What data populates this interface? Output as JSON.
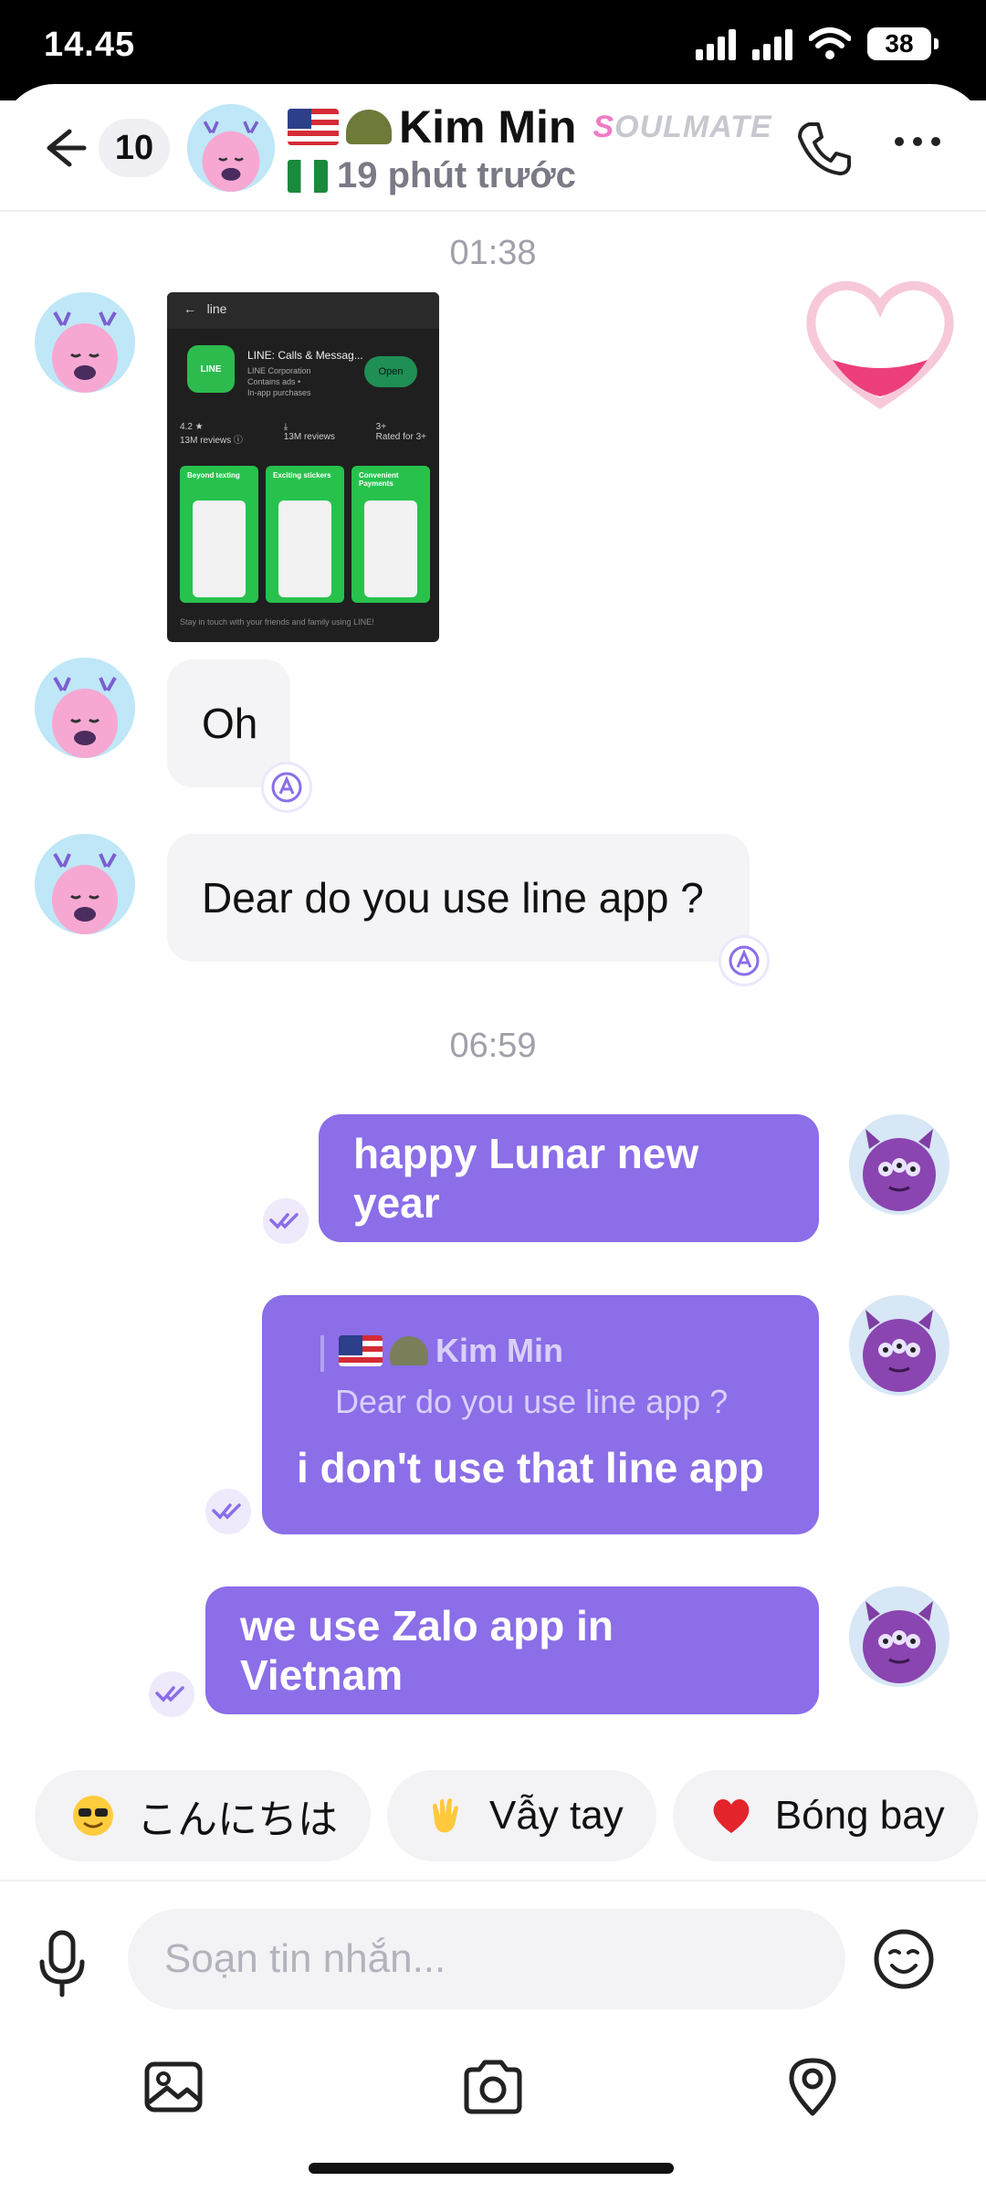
{
  "status_bar": {
    "time": "14.45",
    "battery": "38"
  },
  "header": {
    "unread_count": "10",
    "contact_name": "Kim Min",
    "tag_first": "S",
    "tag_rest": "OULMATE",
    "last_seen": "19 phút trước"
  },
  "messages": {
    "stamp_1": "01:38",
    "image": {
      "search": "line",
      "app_title": "LINE: Calls & Messag...",
      "app_dev": "LINE Corporation",
      "app_note1": "Contains ads •",
      "app_note2": "In-app purchases",
      "open": "Open",
      "rating": "4.2 ★",
      "reviews": "13M reviews ⓘ",
      "downloads": "13M reviews",
      "age": "3+",
      "age_sub": "Rated for 3+",
      "card1": "Beyond texting",
      "card2": "Exciting stickers",
      "card3": "Convenient Payments",
      "footer": "Stay in touch with your friends and family using LINE!"
    },
    "in_1": "Oh",
    "in_2": "Dear do you use line app ?",
    "stamp_2": "06:59",
    "out_1": "happy Lunar new year",
    "quote_name": "Kim Min",
    "quote_text": "Dear do you use line app ?",
    "out_2": "i don't use that line app",
    "out_3": "we use Zalo app in Vietnam"
  },
  "quick_replies": [
    {
      "label": "こんにちは",
      "icon": "sunglasses-emoji-icon"
    },
    {
      "label": "Vẫy tay",
      "icon": "waving-hand-emoji-icon"
    },
    {
      "label": "Bóng bay",
      "icon": "heart-emoji-icon"
    }
  ],
  "composer": {
    "placeholder": "Soạn tin nhắn..."
  },
  "colors": {
    "accent": "#8b6ee8",
    "bubble_in": "#f4f4f7",
    "tag": "#f07cc4"
  }
}
